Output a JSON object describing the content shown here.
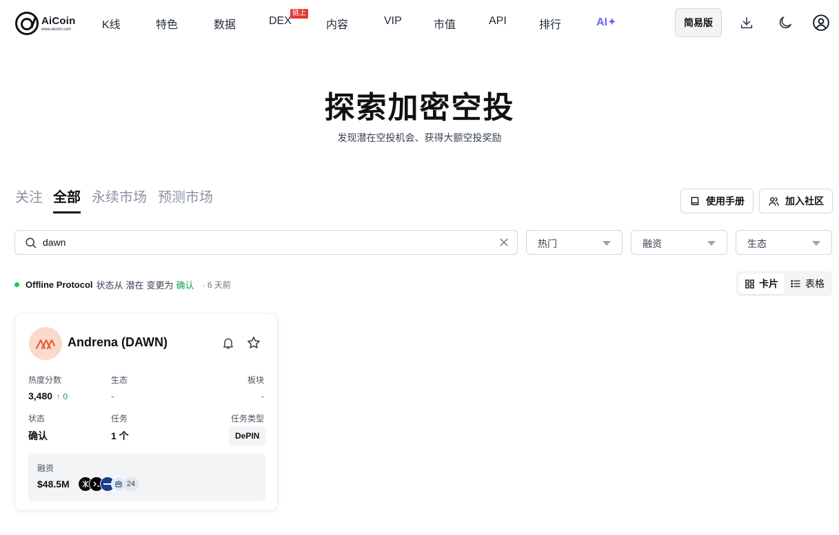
{
  "brand": {
    "name": "AiCoin",
    "url": "www.aicoin.com"
  },
  "nav": {
    "items": [
      {
        "label": "K线"
      },
      {
        "label": "特色"
      },
      {
        "label": "数据"
      },
      {
        "label": "DEX",
        "badge": "链上"
      },
      {
        "label": "内容"
      },
      {
        "label": "VIP"
      },
      {
        "label": "市值"
      },
      {
        "label": "API"
      },
      {
        "label": "排行"
      },
      {
        "label": "AI✦"
      }
    ]
  },
  "header": {
    "simple_version_label": "简易版",
    "icons": [
      "download-icon",
      "moon-icon",
      "user-icon"
    ]
  },
  "hero": {
    "title": "探索加密空投",
    "subtitle": "发现潜在空投机会、获得大额空投奖励"
  },
  "tabs": [
    {
      "label": "关注",
      "active": false
    },
    {
      "label": "全部",
      "active": true
    },
    {
      "label": "永续市场",
      "active": false
    },
    {
      "label": "预测市场",
      "active": false
    }
  ],
  "actions": {
    "manual_label": "使用手册",
    "community_label": "加入社区"
  },
  "filters": {
    "search_value": "dawn",
    "hot_label": "热门",
    "funding_label": "融资",
    "ecosystem_label": "生态"
  },
  "status_update": {
    "project": "Offline Protocol",
    "text_before": "状态从",
    "from_status": "潜在",
    "text_middle": "变更为",
    "to_status": "确认",
    "time": "· 6 天前",
    "dot_color": "#22c55e"
  },
  "view_toggle": {
    "card_label": "卡片",
    "table_label": "表格",
    "active": "card"
  },
  "card": {
    "name": "Andrena (DAWN)",
    "heat_label": "热度分数",
    "heat_value": "3,480",
    "heat_change": "↑ 0",
    "ecosystem_label": "生态",
    "ecosystem_value": "-",
    "sector_label": "板块",
    "sector_value": "-",
    "status_label": "状态",
    "status_value": "确认",
    "tasks_label": "任务",
    "tasks_value": "1 个",
    "task_type_label": "任务类型",
    "task_type_value": "DePIN",
    "funding_label": "融资",
    "funding_value": "$48.5M",
    "investor_count": "24",
    "investors": [
      {
        "icon": "investor-logo-1",
        "color": "#111111"
      },
      {
        "icon": "investor-logo-2",
        "color": "#000000"
      },
      {
        "icon": "investor-logo-3",
        "color": "#1e3a8a"
      },
      {
        "icon": "investor-logo-4",
        "color": "#dbeafe"
      }
    ],
    "accent_color": "#16a34a"
  }
}
